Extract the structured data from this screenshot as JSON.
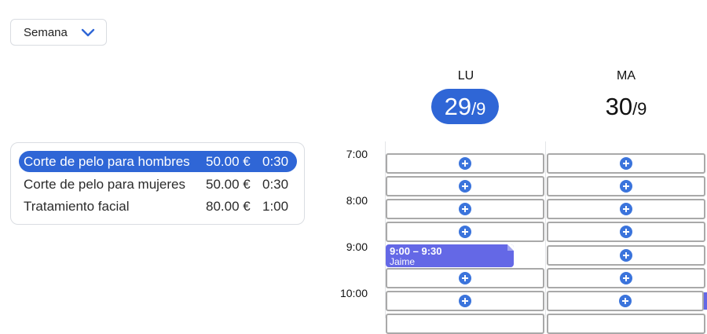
{
  "view_select": {
    "value": "Semana"
  },
  "services": [
    {
      "name": "Corte de pelo para hombres",
      "price": "50.00 €",
      "duration": "0:30",
      "selected": true
    },
    {
      "name": "Corte de pelo para mujeres",
      "price": "50.00 €",
      "duration": "0:30",
      "selected": false
    },
    {
      "name": "Tratamiento facial",
      "price": "80.00 €",
      "duration": "1:00",
      "selected": false
    }
  ],
  "days": [
    {
      "dow": "LU",
      "day": "29",
      "month": "/9",
      "today": true
    },
    {
      "dow": "MA",
      "day": "30",
      "month": "/9",
      "today": false
    }
  ],
  "hours": [
    "7:00",
    "8:00",
    "9:00",
    "10:00"
  ],
  "event": {
    "time": "9:00 – 9:30",
    "who": "Jaime"
  },
  "colors": {
    "accent": "#2f66d6",
    "event": "#6468e6",
    "slot_border": "#a9a9a9"
  }
}
